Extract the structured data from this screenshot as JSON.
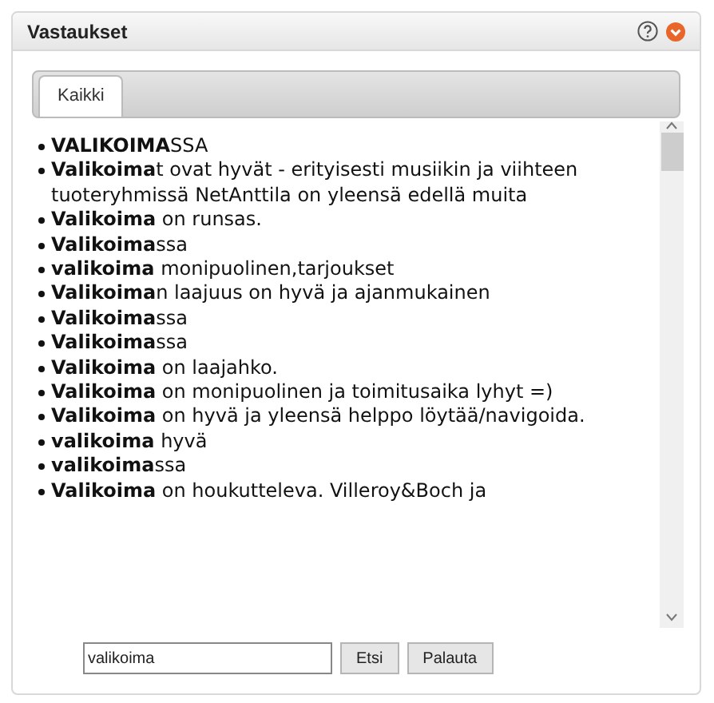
{
  "panel": {
    "title": "Vastaukset"
  },
  "tabs": [
    {
      "label": "Kaikki",
      "selected": true
    }
  ],
  "answers": [
    "**VALIKOIMA**SSA",
    "**Valikoima**t ovat hyvät - erityisesti musiikin ja viihteen tuoteryhmissä NetAnttila on yleensä edellä muita",
    "**Valikoima** on runsas.",
    "**Valikoima**ssa",
    "**valikoima** monipuolinen,tarjoukset",
    "**Valikoima**n laajuus on hyvä ja ajanmukainen",
    "**Valikoima**ssa",
    "**Valikoima**ssa",
    "**Valikoima** on laajahko.",
    "**Valikoima** on monipuolinen ja toimitusaika lyhyt =)",
    "**Valikoima** on hyvä ja yleensä helppo löytää/navigoida.",
    "**valikoima** hyvä",
    "**valikoima**ssa",
    "**Valikoima** on houkutteleva. Villeroy&Boch ja"
  ],
  "search": {
    "value": "valikoima"
  },
  "buttons": [
    "Etsi",
    "Palauta"
  ]
}
